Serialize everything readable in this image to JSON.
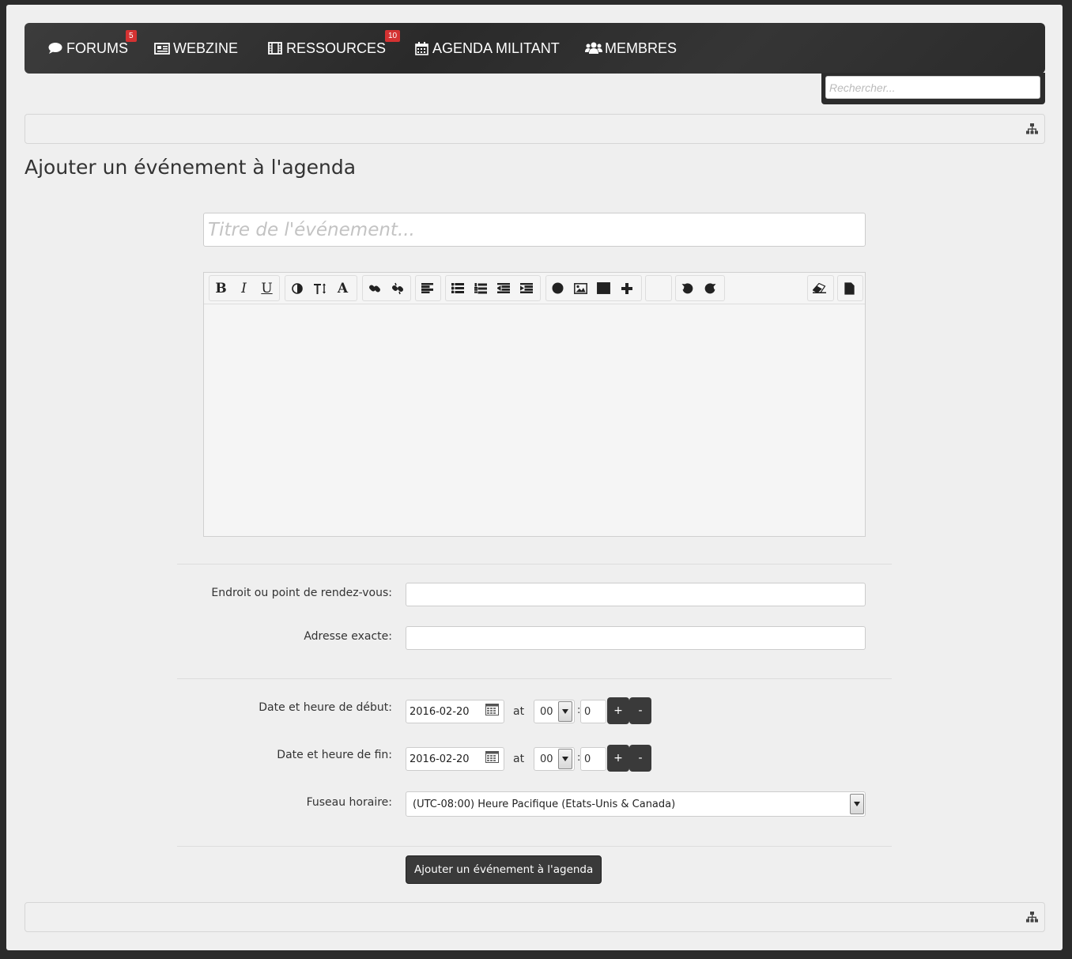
{
  "nav": {
    "items": [
      {
        "label": "FORUMS",
        "icon": "comment-icon",
        "badge": "5"
      },
      {
        "label": "WEBZINE",
        "icon": "newspaper-icon"
      },
      {
        "label": "RESSOURCES",
        "icon": "film-icon",
        "badge": "10"
      },
      {
        "label": "AGENDA MILITANT",
        "icon": "calendar-icon"
      },
      {
        "label": "MEMBRES",
        "icon": "users-icon"
      }
    ],
    "search_placeholder": "Rechercher..."
  },
  "page_title": "Ajouter un événement à l'agenda",
  "event_title_placeholder": "Titre de l'événement...",
  "editor": {
    "toolbar": [
      "bold",
      "italic",
      "underline",
      "color",
      "font-size",
      "font",
      "link",
      "unlink",
      "align",
      "bullet-list",
      "numbered-list",
      "outdent",
      "indent",
      "emoticon",
      "image",
      "video",
      "more",
      "blank",
      "undo",
      "redo",
      "eraser",
      "source"
    ],
    "labels": {
      "bold": "B",
      "italic": "I",
      "underline": "U",
      "font": "A"
    }
  },
  "form": {
    "location_label": "Endroit ou point de rendez-vous:",
    "location_value": "",
    "address_label": "Adresse exacte:",
    "address_value": "",
    "start_label": "Date et heure de début:",
    "start_date": "2016-02-20",
    "start_hour": "00",
    "start_minute": "0",
    "end_label": "Date et heure de fin:",
    "end_date": "2016-02-20",
    "end_hour": "00",
    "end_minute": "0",
    "at_label": "at",
    "colon": ":",
    "plus_label": "+",
    "minus_label": "-",
    "timezone_label": "Fuseau horaire:",
    "timezone_value": "(UTC-08:00) Heure Pacifique (Etats-Unis & Canada)",
    "submit_label": "Ajouter un événement à l'agenda"
  }
}
